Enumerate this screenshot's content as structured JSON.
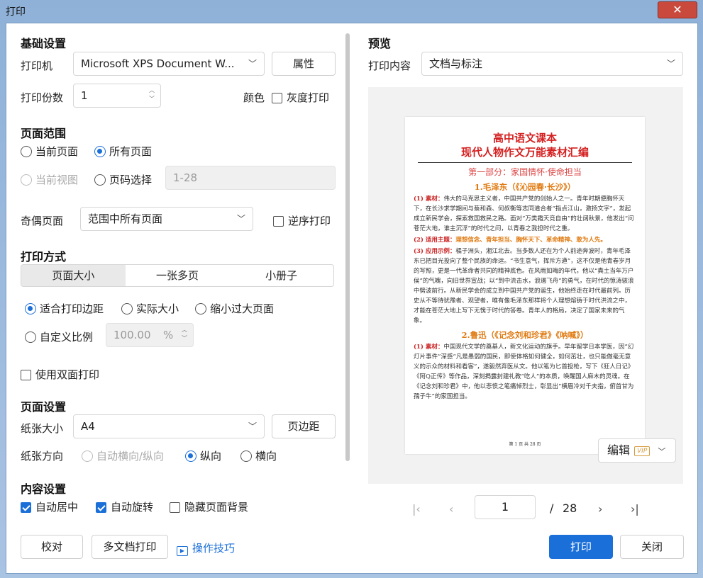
{
  "window": {
    "title": "打印",
    "close_icon": "close-icon"
  },
  "basic": {
    "section": "基础设置",
    "printer_label": "打印机",
    "printer_value": "Microsoft XPS Document W...",
    "properties_button": "属性",
    "copies_label": "打印份数",
    "copies_value": "1",
    "color_label": "颜色",
    "grayscale_label": "灰度打印"
  },
  "page_range": {
    "section": "页面范围",
    "current_page": "当前页面",
    "all_pages": "所有页面",
    "current_view": "当前视图",
    "page_select": "页码选择",
    "page_select_value": "1-28",
    "odd_even_label": "奇偶页面",
    "odd_even_value": "范围中所有页面",
    "reverse_label": "逆序打印"
  },
  "print_mode": {
    "section": "打印方式",
    "tabs": [
      "页面大小",
      "一张多页",
      "小册子"
    ],
    "fit_margin": "适合打印边距",
    "actual_size": "实际大小",
    "shrink_large": "缩小过大页面",
    "custom_scale": "自定义比例",
    "custom_scale_value": "100.00",
    "custom_scale_unit": "%",
    "duplex_label": "使用双面打印"
  },
  "page_setup": {
    "section": "页面设置",
    "paper_size_label": "纸张大小",
    "paper_size_value": "A4",
    "margins_button": "页边距",
    "orientation_label": "纸张方向",
    "auto_orientation": "自动横向/纵向",
    "portrait": "纵向",
    "landscape": "横向"
  },
  "content_setup": {
    "section": "内容设置",
    "auto_center": "自动居中",
    "auto_rotate": "自动旋转",
    "hide_background": "隐藏页面背景"
  },
  "preview": {
    "section": "预览",
    "content_label": "打印内容",
    "content_value": "文档与标注",
    "edit_button": "编辑",
    "vip_badge": "VIP",
    "current_page": "1",
    "page_sep": "/",
    "total_pages": "28"
  },
  "doc": {
    "title1": "高中语文课本",
    "title2": "现代人物作文万能素材汇编",
    "part": "第一部分：家国情怀·使命担当",
    "head1": "1.毛泽东（《沁园春·长沙》）",
    "p1_tag": "(1) 素材：",
    "p1_text": "伟大的马克思主义者，中国共产党的创始人之一。青年时期便胸怀天下，在长沙求学期间与蔡和森、何叔衡等志同道合者“指点江山，激扬文字”，发起成立新民学会，探索救国救民之路。面对“万类霜天竞自由”的壮阔秋景，他发出“问苍茫大地，谁主沉浮”的时代之问，以青春之我担时代之重。",
    "p2_tag": "(2) 适用主题：",
    "p2_text": "理想信念、青年担当、胸怀天下、革命精神、敢为人先。",
    "p3_tag": "(3) 应用示例：",
    "p3_text": "橘子洲头，湘江北去。当多数人还在为个人前途奔波时，青年毛泽东已把目光投向了整个民族的命运。“书生意气，挥斥方遒”，这不仅是他青春岁月的写照，更是一代革命者共同的精神底色。在风雨如晦的年代，他以“粪土当年万户侯”的气魄，向旧世界宣战；以“到中流击水，浪遏飞舟”的勇气，在时代的惊涛骇浪中劈波前行。从新民学会的成立到中国共产党的诞生，他始终走在时代最前列。历史从不等待犹豫者、观望者，唯有像毛泽东那样将个人理想熔铸于时代洪流之中，才能在苍茫大地上写下无愧于时代的答卷。青年人的格局，决定了国家未来的气象。",
    "head2": "2.鲁迅（《记念刘和珍君》《呐喊》）",
    "p4_tag": "(1) 素材：",
    "p4_text": "中国现代文学的奠基人，新文化运动的旗手。早年留学日本学医，因“幻灯片事件”深感“凡是愚弱的国民，即使体格如何健全，如何茁壮，也只能做毫无意义的示众的材料和看客”，遂毅然弃医从文。他以笔为匕首投枪，写下《狂人日记》《阿Q正传》等作品，深刻揭露封建礼教“吃人”的本质，唤醒国人麻木的灵魂。在《记念刘和珍君》中，他以悲愤之笔痛悼烈士，彰显出“横眉冷对千夫指，俯首甘为孺子牛”的家国担当。",
    "footer": "第 1 页 共 28 页"
  },
  "footer": {
    "proof_button": "校对",
    "multi_doc_button": "多文档打印",
    "tips_link": "操作技巧",
    "print_button": "打印",
    "close_button": "关闭"
  }
}
